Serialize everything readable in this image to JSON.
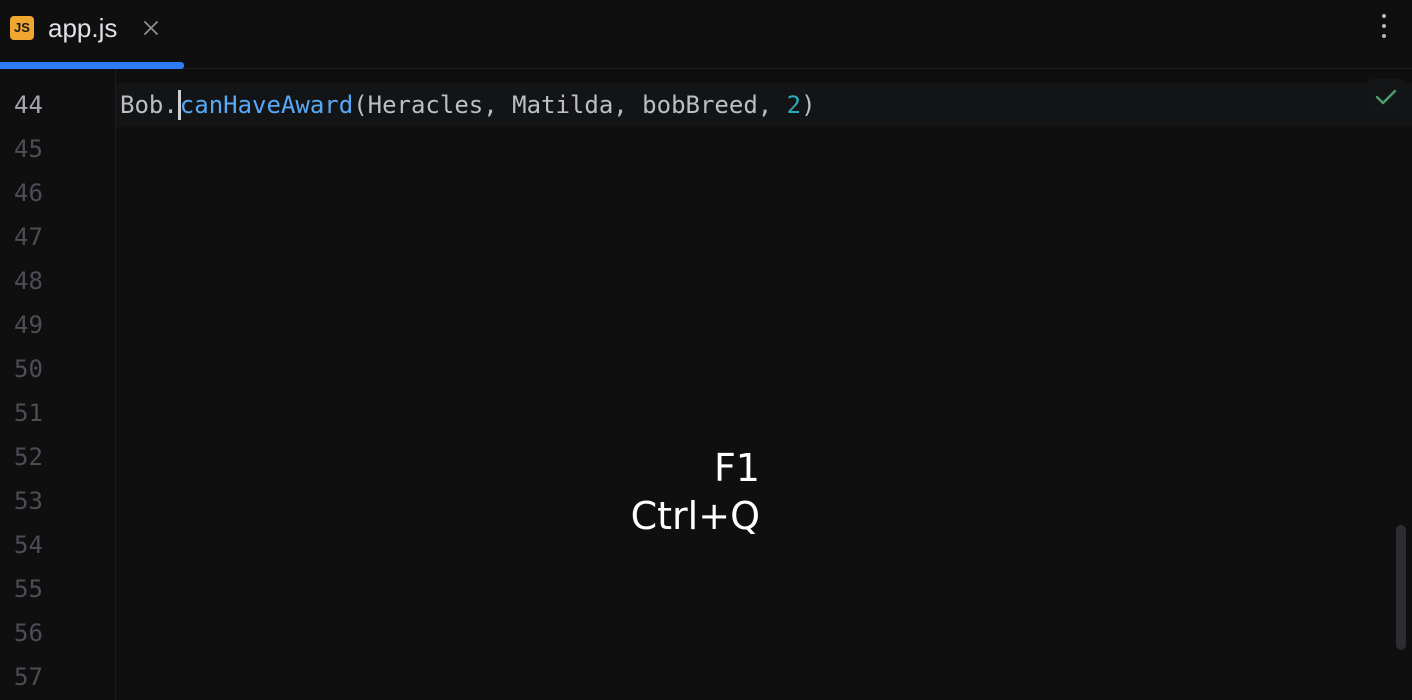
{
  "tab": {
    "file_icon_text": "JS",
    "label": "app.js"
  },
  "colors": {
    "accent": "#2e7bf6",
    "file_icon": "#f0a732",
    "method": "#57a8f5",
    "number": "#2aacb8",
    "ok_check": "#4ca06a"
  },
  "icons": {
    "tab_close": "close-icon",
    "menu": "kebab-menu-icon",
    "inspection": "checkmark-icon"
  },
  "editor": {
    "line_numbers": [
      "44",
      "45",
      "46",
      "47",
      "48",
      "49",
      "50",
      "51",
      "52",
      "53",
      "54",
      "55",
      "56",
      "57"
    ],
    "current_line": "44",
    "code": {
      "object": "Bob.",
      "method": "canHaveAward",
      "args_open": "(Heracles, Matilda, bobBreed, ",
      "number_arg": "2",
      "args_close": ")"
    }
  },
  "key_overlay": {
    "line1": "F1",
    "line2": "Ctrl+Q"
  }
}
